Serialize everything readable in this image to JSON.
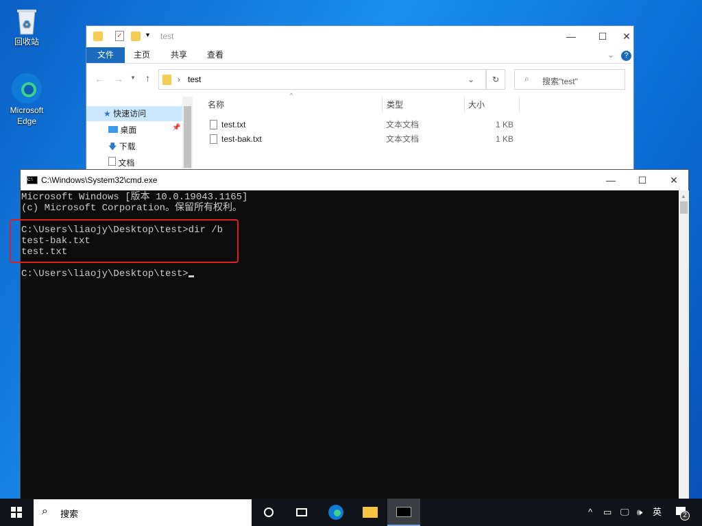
{
  "desktop": {
    "icons": [
      {
        "label": "回收站"
      },
      {
        "label": "Microsoft Edge"
      }
    ]
  },
  "explorer": {
    "title": "test",
    "ribbon_tabs": [
      "文件",
      "主页",
      "共享",
      "查看"
    ],
    "address": "test",
    "search_placeholder": "搜索\"test\"",
    "nav": [
      "快速访问",
      "桌面",
      "下载",
      "文档"
    ],
    "columns": [
      "名称",
      "类型",
      "大小"
    ],
    "files": [
      {
        "name": "test.txt",
        "type": "文本文档",
        "size": "1 KB"
      },
      {
        "name": "test-bak.txt",
        "type": "文本文档",
        "size": "1 KB"
      }
    ]
  },
  "cmd": {
    "title": "C:\\Windows\\System32\\cmd.exe",
    "lines": [
      "Microsoft Windows [版本 10.0.19043.1165]",
      "(c) Microsoft Corporation。保留所有权利。",
      "",
      "C:\\Users\\liaojy\\Desktop\\test>dir /b",
      "test-bak.txt",
      "test.txt",
      "",
      "C:\\Users\\liaojy\\Desktop\\test>"
    ],
    "highlight_color": "#e0201c"
  },
  "taskbar": {
    "search_placeholder": "搜索",
    "ime": "英",
    "notification_count": "2"
  }
}
